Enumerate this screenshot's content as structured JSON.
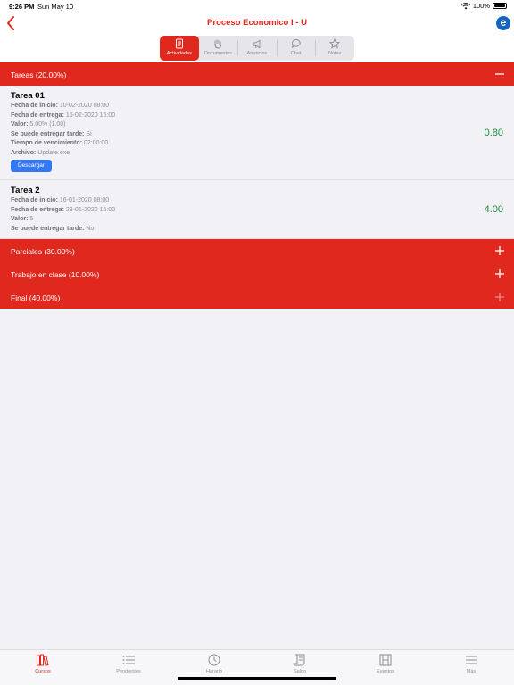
{
  "status": {
    "time": "9:26 PM",
    "date": "Sun May 10",
    "battery": "100%"
  },
  "nav": {
    "title": "Proceso Economico I - U",
    "logo_letter": "e"
  },
  "segments": [
    "Actividades",
    "Documentos",
    "Anuncios",
    "Chat",
    "Notas"
  ],
  "sections": {
    "tareas": "Tareas (20.00%)",
    "parciales": "Parciales (30.00%)",
    "trabajo": "Trabajo en clase (10.00%)",
    "final": "Final (40.00%)"
  },
  "tasks": [
    {
      "name": "Tarea 01",
      "fields": [
        {
          "label": "Fecha de inicio:",
          "value": "10-02-2020 08:00"
        },
        {
          "label": "Fecha de entrega:",
          "value": "16-02-2020 15:00"
        },
        {
          "label": "Valor:",
          "value": "5.00% (1.00)"
        },
        {
          "label": "Se puede entregar tarde:",
          "value": "Si"
        },
        {
          "label": "Tiempo de vencimiento:",
          "value": "02:00:00"
        },
        {
          "label": "Archivo:",
          "value": "Update.exe"
        }
      ],
      "button": "Descargar",
      "grade": "0.80"
    },
    {
      "name": "Tarea 2",
      "fields": [
        {
          "label": "Fecha de inicio:",
          "value": "16-01-2020 08:00"
        },
        {
          "label": "Fecha de entrega:",
          "value": "23-01-2020 15:00"
        },
        {
          "label": "Valor:",
          "value": "5"
        },
        {
          "label": "Se puede entregar tarde:",
          "value": "No"
        }
      ],
      "grade": "4.00"
    }
  ],
  "tabs": [
    "Cursos",
    "Pendientes",
    "Horario",
    "Saldo",
    "Eventos",
    "Más"
  ],
  "colors": {
    "accent": "#e0281e",
    "grade": "#1e8a3e",
    "button": "#3478f6"
  }
}
